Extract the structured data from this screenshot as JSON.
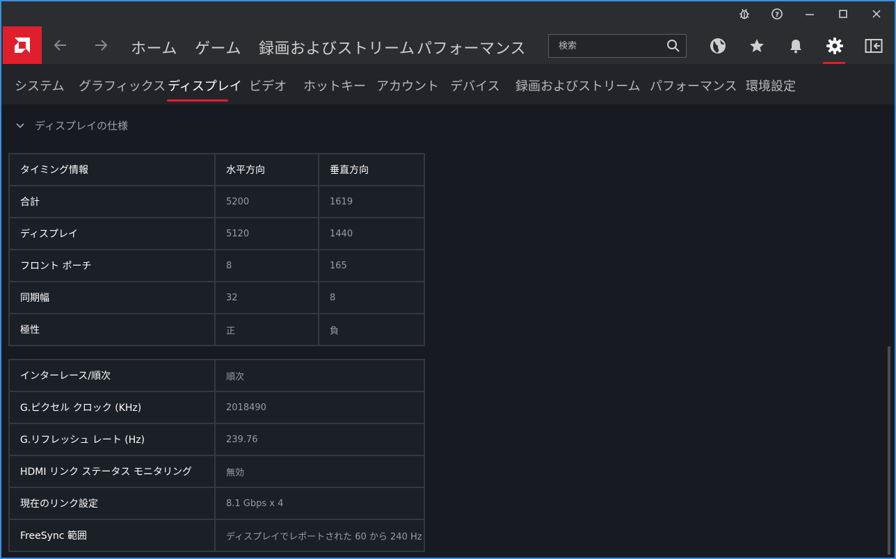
{
  "titlebar": {
    "buttons": [
      "bug-icon",
      "help-icon",
      "minimize-icon",
      "maximize-icon",
      "close-icon"
    ]
  },
  "nav": {
    "items": [
      "ホーム",
      "ゲーム",
      "録画およびストリーム",
      "パフォーマンス"
    ],
    "search_placeholder": "検索",
    "icons": [
      "globe-icon",
      "star-icon",
      "bell-icon",
      "gear-icon",
      "sidebar-toggle-icon"
    ],
    "accent_color": "#e01f2d"
  },
  "subnav": {
    "items": [
      "システム",
      "グラフィックス",
      "ディスプレイ",
      "ビデオ",
      "ホットキー",
      "アカウント",
      "デバイス",
      "録画およびストリーム",
      "パフォーマンス",
      "環境設定"
    ],
    "active": "ディスプレイ"
  },
  "section": {
    "title": "ディスプレイの仕様"
  },
  "timing_table": {
    "headers": [
      "タイミング情報",
      "水平方向",
      "垂直方向"
    ],
    "rows": [
      {
        "label": "合計",
        "h": "5200",
        "v": "1619"
      },
      {
        "label": "ディスプレイ",
        "h": "5120",
        "v": "1440"
      },
      {
        "label": "フロント ポーチ",
        "h": "8",
        "v": "165"
      },
      {
        "label": "同期幅",
        "h": "32",
        "v": "8"
      },
      {
        "label": "極性",
        "h": "正",
        "v": "負"
      }
    ]
  },
  "info_table": {
    "rows": [
      {
        "label": "インターレース/順次",
        "value": "順次"
      },
      {
        "label": "G.ピクセル クロック (KHz)",
        "value": "2018490"
      },
      {
        "label": "G.リフレッシュ レート (Hz)",
        "value": "239.76"
      },
      {
        "label": "HDMI リンク ステータス モニタリング",
        "value": "無効"
      },
      {
        "label": "現在のリンク設定",
        "value": "8.1 Gbps x 4"
      },
      {
        "label": "FreeSync 範囲",
        "value": "ディスプレイでレポートされた 60 から 240 Hz"
      }
    ]
  }
}
